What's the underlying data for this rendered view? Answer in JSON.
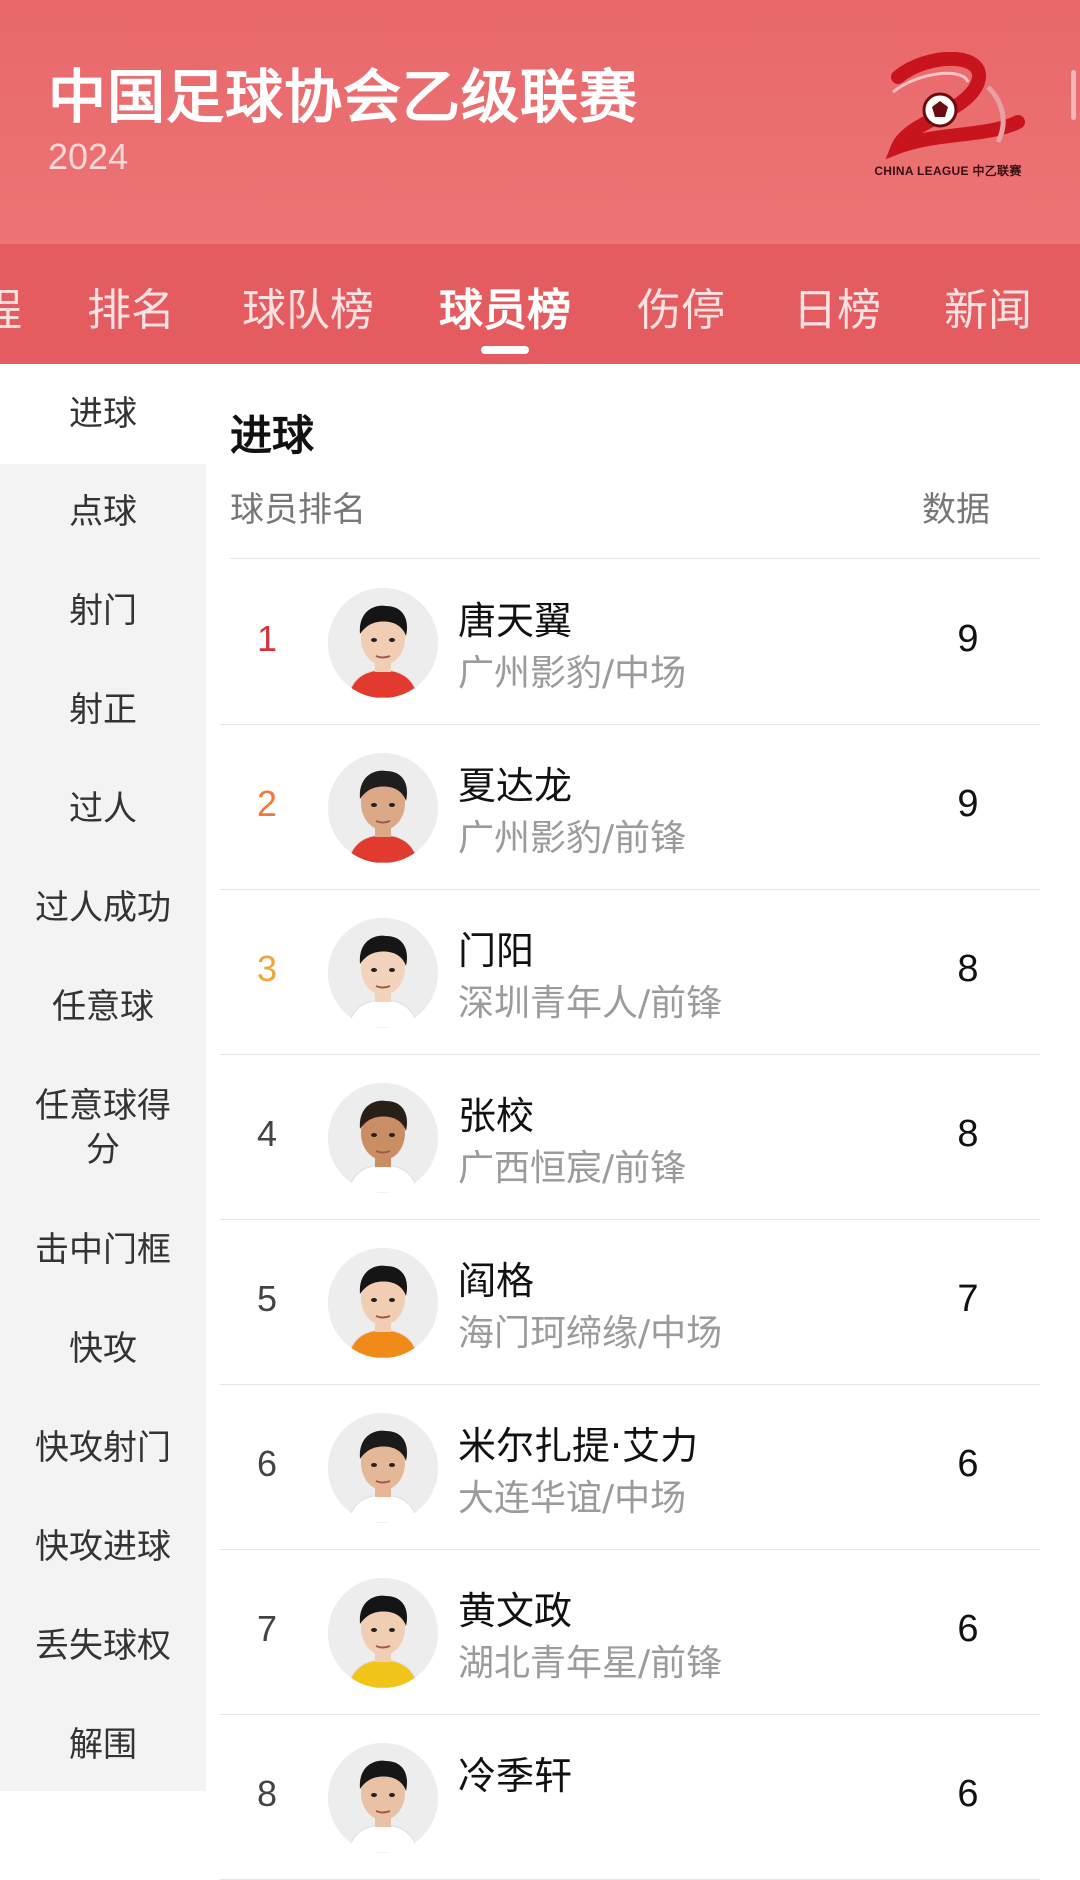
{
  "header": {
    "title": "中国足球协会乙级联赛",
    "year": "2024",
    "logo_text": "CHINA LEAGUE 中乙联赛"
  },
  "tabs": [
    {
      "label": "程",
      "active": false
    },
    {
      "label": "排名",
      "active": false
    },
    {
      "label": "球队榜",
      "active": false
    },
    {
      "label": "球员榜",
      "active": true
    },
    {
      "label": "伤停",
      "active": false
    },
    {
      "label": "日榜",
      "active": false
    },
    {
      "label": "新闻",
      "active": false
    }
  ],
  "sidebar": {
    "items": [
      {
        "label": "进球",
        "active": true
      },
      {
        "label": "点球"
      },
      {
        "label": "射门"
      },
      {
        "label": "射正"
      },
      {
        "label": "过人"
      },
      {
        "label": "过人成功"
      },
      {
        "label": "任意球"
      },
      {
        "label": "任意球得",
        "label2": "分"
      },
      {
        "label": "击中门框"
      },
      {
        "label": "快攻"
      },
      {
        "label": "快攻射门"
      },
      {
        "label": "快攻进球"
      },
      {
        "label": "丢失球权"
      },
      {
        "label": "解围"
      }
    ]
  },
  "main": {
    "section_title": "进球",
    "col_player": "球员排名",
    "col_data": "数据",
    "rows": [
      {
        "rank": "1",
        "name": "唐天翼",
        "team": "广州影豹/中场",
        "value": "9",
        "rank_color": "#d8323a"
      },
      {
        "rank": "2",
        "name": "夏达龙",
        "team": "广州影豹/前锋",
        "value": "9",
        "rank_color": "#ee7a3c"
      },
      {
        "rank": "3",
        "name": "门阳",
        "team": "深圳青年人/前锋",
        "value": "8",
        "rank_color": "#f0a53a"
      },
      {
        "rank": "4",
        "name": "张校",
        "team": "广西恒宸/前锋",
        "value": "8",
        "rank_color": "#444444"
      },
      {
        "rank": "5",
        "name": "阎格",
        "team": "海门珂缔缘/中场",
        "value": "7",
        "rank_color": "#444444"
      },
      {
        "rank": "6",
        "name": "米尔扎提·艾力",
        "team": "大连华谊/中场",
        "value": "6",
        "rank_color": "#444444"
      },
      {
        "rank": "7",
        "name": "黄文政",
        "team": "湖北青年星/前锋",
        "value": "6",
        "rank_color": "#444444"
      },
      {
        "rank": "8",
        "name": "冷季轩",
        "team": "",
        "value": "6",
        "rank_color": "#444444"
      }
    ]
  },
  "colors": {
    "header_bg": "#e9686a",
    "tabs_bg": "#e45c5f",
    "sidebar_bg": "#f3f3f3"
  }
}
